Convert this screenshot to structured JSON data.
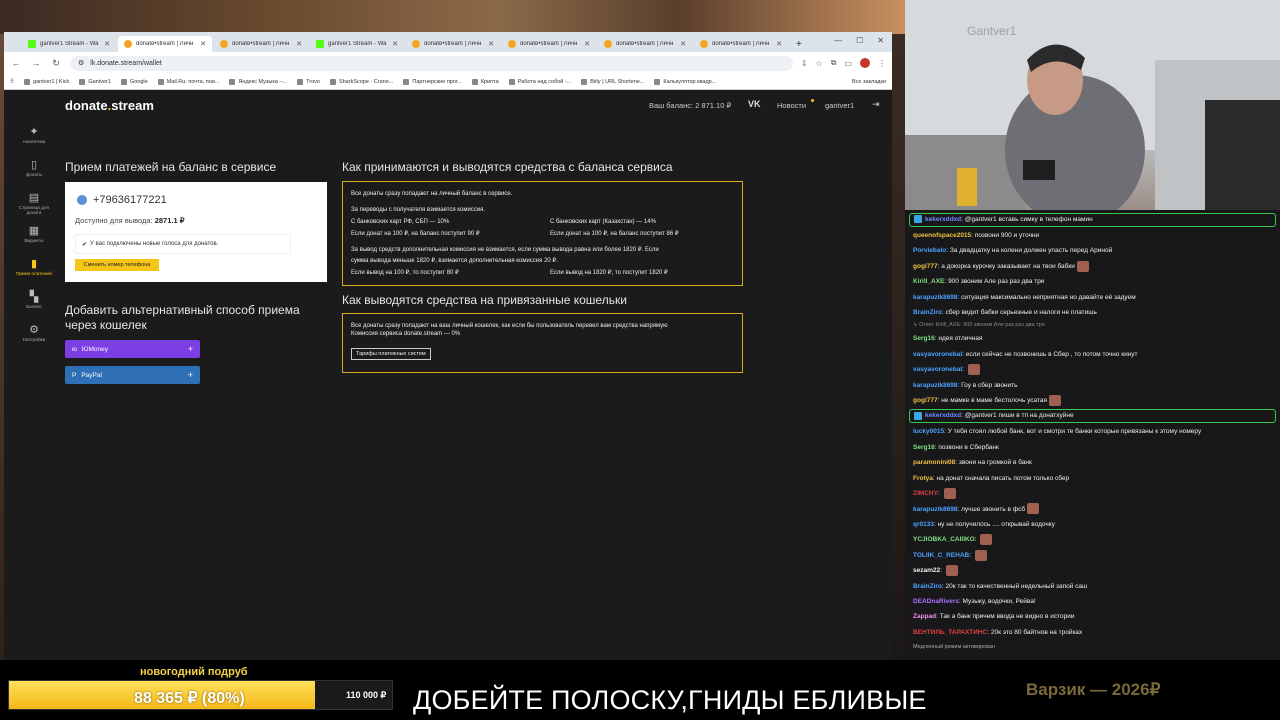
{
  "browser": {
    "tabs": [
      {
        "title": "gantver1 Stream - Wa",
        "icon": "kick-favicon",
        "active": false
      },
      {
        "title": "donate•stream | Личн",
        "icon": "donate-favicon",
        "active": true
      },
      {
        "title": "donate•stream | Личн",
        "icon": "donate-favicon",
        "active": false
      },
      {
        "title": "gantver1 Stream - Wa",
        "icon": "kick-favicon",
        "active": false
      },
      {
        "title": "donate•stream | Личн",
        "icon": "donate-favicon",
        "active": false
      },
      {
        "title": "donate•stream | Личн",
        "icon": "donate-favicon",
        "active": false
      },
      {
        "title": "donate•stream | Личн",
        "icon": "donate-favicon",
        "active": false
      },
      {
        "title": "donate•stream | Личн",
        "icon": "donate-favicon",
        "active": false
      }
    ],
    "url": "lk.donate.stream/wallet",
    "bookmarks": [
      "gantver1 | Kick",
      "Gantver1",
      "Google",
      "Mail.Ru: почта, пои...",
      "Яндекс Музыка –...",
      "Trovo",
      "SharkScope - Crane...",
      "Партнерские прог...",
      "Крипта",
      "Работа над собой -...",
      "Bitly | URL Shortene...",
      "Калькулятор квадр..."
    ],
    "bookmarks_all": "Все закладки"
  },
  "site": {
    "logo_a": "donate",
    "logo_dot": ".",
    "logo_b": "stream",
    "balance": "Ваш баланс: 2 871.10 ₽",
    "vk": "VK",
    "news": "Новости",
    "username": "gantver1"
  },
  "sidebar": [
    {
      "label": "Аналитика",
      "icon": "analytics-icon",
      "glyph": "✦",
      "active": false
    },
    {
      "label": "Донаты",
      "icon": "donations-icon",
      "glyph": "▯",
      "active": false
    },
    {
      "label": "Страница для доната",
      "icon": "page-icon",
      "glyph": "▤",
      "active": false
    },
    {
      "label": "Виджеты",
      "icon": "widgets-icon",
      "glyph": "▦",
      "active": false
    },
    {
      "label": "Прием платежей",
      "icon": "payments-icon",
      "glyph": "▮",
      "active": true
    },
    {
      "label": "Баланс",
      "icon": "balance-icon",
      "glyph": "▚",
      "active": false
    },
    {
      "label": "Настройки",
      "icon": "settings-icon",
      "glyph": "⚙",
      "active": false
    }
  ],
  "main": {
    "left_title": "Прием платежей на баланс в сервисе",
    "phone": "+79636177221",
    "avail_label": "Доступно для вывода:",
    "avail_value": "2871.1 ₽",
    "voices_note": "У вас подключены новые голоса для донатов.",
    "change_btn": "Сменить номер телефона",
    "alt_title_1": "Добавить альтернативный способ приема",
    "alt_title_2": "через кошелек",
    "wallet_1": "ЮMoney",
    "wallet_2": "PayPal",
    "right_title_1": "Как принимаются и выводятся средства с баланса сервиса",
    "box1": {
      "line1": "Все донаты сразу попадают на личный баланс в сервисе.",
      "line2": "За переводы с получателя взимается комиссия.",
      "col_a_title": "С банковских карт РФ, СБП — 10%",
      "col_a_sub": "Если донат на 100 ₽, на баланс поступит 90 ₽",
      "col_b_title": "С банковских карт (Казахстан) — 14%",
      "col_b_sub": "Если донат на 100 ₽, на баланс поступит 86 ₽",
      "line3a": "За вывод средств дополнительная комиссия не взимается, если сумма вывода равна или более 1820 ₽. Если",
      "line3b": "сумма вывода меньше 1820 ₽, взимается дополнительная комиссия 20 ₽.",
      "sub_a": "Если вывод на 100 ₽, то поступит 80 ₽",
      "sub_b": "Если вывод на 1820 ₽, то поступит 1820 ₽"
    },
    "right_title_2": "Как выводятся средства на привязанные кошельки",
    "box2": {
      "line1": "Все донаты сразу попадают на ваш личный кошелек, как если бы пользователь перевел вам средства напрямую",
      "line2": "Комиссия сервиса donate.stream — 0%",
      "btn": "Тарифы платежных систем"
    }
  },
  "webcam": {
    "wall_text": "Gantver1"
  },
  "chat": [
    {
      "user": "kekerxddxd",
      "color": "#6f8cff",
      "text": "@gantver1 вставь симку в телефон мамин",
      "hl": true
    },
    {
      "user": "queenofspace2015",
      "color": "#f0c040",
      "text": "позвони 900 и уточни"
    },
    {
      "user": "Porviebalo",
      "color": "#4aa3ff",
      "text": "За двадцатку на колени должен упасть перед Ариной"
    },
    {
      "user": "gogi777",
      "color": "#f0c040",
      "text": "а докорка курочку заказывает на твои бабки",
      "emote": true
    },
    {
      "user": "Kirill_AXE",
      "color": "#7ee07e",
      "text": "900 звоним Але раз раз два три"
    },
    {
      "user": "karapuzik8698",
      "color": "#4aa3ff",
      "text": "ситуация максимально неприятная но давайте её задуем"
    },
    {
      "user": "BrainZiro",
      "color": "#4aa3ff",
      "text": "сбер видит бабки серьезные и налоги не платишь"
    },
    {
      "reply": "↳ Ответ Kirill_AXE: 900 звоним Але раз раз два три"
    },
    {
      "user": "Serg16",
      "color": "#7ee07e",
      "text": "идея отличная"
    },
    {
      "user": "vasyavoronebal",
      "color": "#4aa3ff",
      "text": "если сейчас не позвонишь в Сбер , то потом точно кинут"
    },
    {
      "user": "vasyavoronebal",
      "color": "#4aa3ff",
      "text": "",
      "emote": true
    },
    {
      "user": "karapuzik8698",
      "color": "#4aa3ff",
      "text": "Гоу в сбер звонить"
    },
    {
      "user": "gogi777",
      "color": "#f0c040",
      "text": "не мамке в маме бестолочь усатая",
      "emote": true
    },
    {
      "user": "kekerxddxd",
      "color": "#6f8cff",
      "text": "@gantver1 пиши в тп на донатхуйне",
      "hl": true
    },
    {
      "user": "lucky0015",
      "color": "#4aa3ff",
      "text": "У тебя стоял любой банк, вот и смотри те банки которые привязаны к этому номеру"
    },
    {
      "user": "Serg16",
      "color": "#7ee07e",
      "text": "позвони в Сбербанк"
    },
    {
      "user": "paramonini08",
      "color": "#f0c040",
      "text": "звони на громкой в банк"
    },
    {
      "user": "Frotya",
      "color": "#f0c040",
      "text": "на донат сначала писать потом только сбер"
    },
    {
      "user": "ZIMCHY",
      "color": "#e04040",
      "text": "",
      "emote": true
    },
    {
      "user": "karapuzik8698",
      "color": "#4aa3ff",
      "text": "лучше звонить в фсб",
      "emote": true
    },
    {
      "user": "qr0133",
      "color": "#4aa3ff",
      "text": "ну не получилось .... открывай водочку"
    },
    {
      "user": "YCJIOBKA_CAIIIKO",
      "color": "#7ee07e",
      "text": "",
      "emote": true
    },
    {
      "user": "TOLIIK_C_REHAB",
      "color": "#4aa3ff",
      "text": "",
      "emote": true
    },
    {
      "user": "sezam22",
      "color": "#f0f0f0",
      "text": "",
      "emote": true
    },
    {
      "user": "BrainZiro",
      "color": "#4aa3ff",
      "text": "20к так то качественный недельный запой саш"
    },
    {
      "user": "DEADnaRivers",
      "color": "#b070ff",
      "text": "Музыку, водочки, Рейва!"
    },
    {
      "user": "Zappad",
      "color": "#f090f0",
      "text": "Так а банк причем ввода не видно в истории"
    },
    {
      "user": "ВЕНТИЛЬ_ТАРАХТИНС",
      "color": "#e04040",
      "text": "20к это 80 байтнов на тройках"
    },
    {
      "sys": "Медленный режим активирован"
    }
  ],
  "overlay": {
    "goal_title": "новогодний подруб",
    "goal_amount": "88 365 ₽ (80%)",
    "goal_progress": 0.8,
    "goal_total": "110 000 ₽",
    "ticker": "ДОБЕЙТЕ ПОЛОСКУ,ГНИДЫ ЕБЛИВЫЕ",
    "side_title": "Варзик — 2026₽"
  }
}
